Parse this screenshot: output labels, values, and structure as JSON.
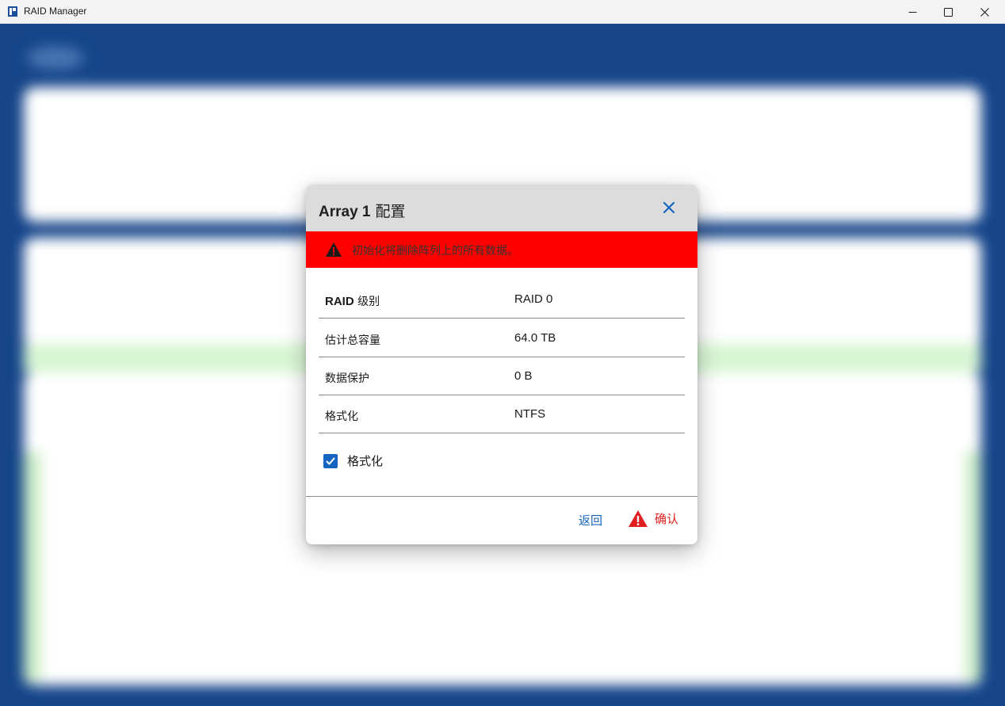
{
  "window": {
    "title": "RAID Manager"
  },
  "dialog": {
    "title_bold": "Array 1",
    "title_rest": " 配置",
    "warning_text": "初始化将删除阵列上的所有数据。",
    "rows": [
      {
        "label_bold": "RAID",
        "label_rest": " 级别",
        "value": "RAID 0"
      },
      {
        "label": "估计总容量",
        "value": "64.0 TB"
      },
      {
        "label": "数据保护",
        "value": "0 B"
      },
      {
        "label": "格式化",
        "value": "NTFS"
      }
    ],
    "format_checkbox": {
      "label": "格式化",
      "checked": true
    },
    "back_label": "返回",
    "confirm_label": "确认"
  },
  "colors": {
    "header_bg": "#dcdcdc",
    "warning_bg": "#ff0000",
    "primary_blue": "#1565c0",
    "danger_red": "#e02020",
    "app_bg_blue": "#0d3e86"
  },
  "icons": {
    "close": "close-icon",
    "warning": "warning-triangle-icon",
    "checkbox": "checkmark-icon",
    "confirm": "warning-triangle-icon"
  }
}
